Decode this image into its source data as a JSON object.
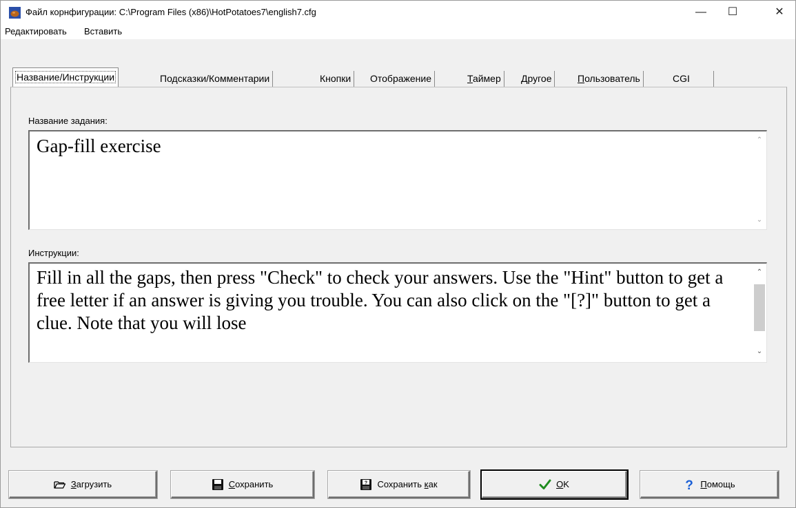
{
  "window": {
    "title": "Файл корнфигурации: C:\\Program Files (x86)\\HotPotatoes7\\english7.cfg",
    "controls": {
      "minimize": "—",
      "maximize": "☐",
      "close": "✕"
    }
  },
  "menu": {
    "items": [
      {
        "label": "Редактировать"
      },
      {
        "label": "Вставить"
      }
    ]
  },
  "tabs": [
    {
      "label": "Название/Инструкции",
      "active": true
    },
    {
      "label": "Подсказки/Комментарии"
    },
    {
      "label": "Кнопки"
    },
    {
      "label": "Отображение"
    },
    {
      "label": "Таймер",
      "accel": "Т",
      "rest": "аймер"
    },
    {
      "label": "Другое"
    },
    {
      "label": "Пользователь",
      "accel": "П",
      "rest": "ользователь"
    },
    {
      "label": "CGI"
    }
  ],
  "panel": {
    "title_label": "Название задания:",
    "title_value": "Gap-fill exercise",
    "instructions_label": "Инструкции:",
    "instructions_value": "Fill in all the gaps, then press \"Check\" to check your answers. Use the \"Hint\" button to get a free letter if an answer is giving you trouble. You can also click on the \"[?]\" button to get a clue. Note that you will lose"
  },
  "buttons": {
    "load": {
      "accel": "З",
      "rest": "агрузить",
      "icon": "folder-open-icon"
    },
    "save": {
      "accel": "С",
      "rest": "охранить",
      "icon": "floppy-disk-icon"
    },
    "save_as": {
      "prefix": "Сохранить ",
      "accel": "к",
      "rest": "ак",
      "icon": "save-as-icon"
    },
    "ok": {
      "accel": "O",
      "rest": "K",
      "icon": "checkmark-icon"
    },
    "help": {
      "accel": "П",
      "rest": "омощь",
      "icon": "question-mark-icon"
    }
  },
  "colors": {
    "window_bg": "#f0f0f0",
    "textbox_bg": "#ffffff",
    "check_green": "#1e8c1e",
    "help_blue": "#1a5fd6",
    "icon_orange": "#d2691e"
  }
}
